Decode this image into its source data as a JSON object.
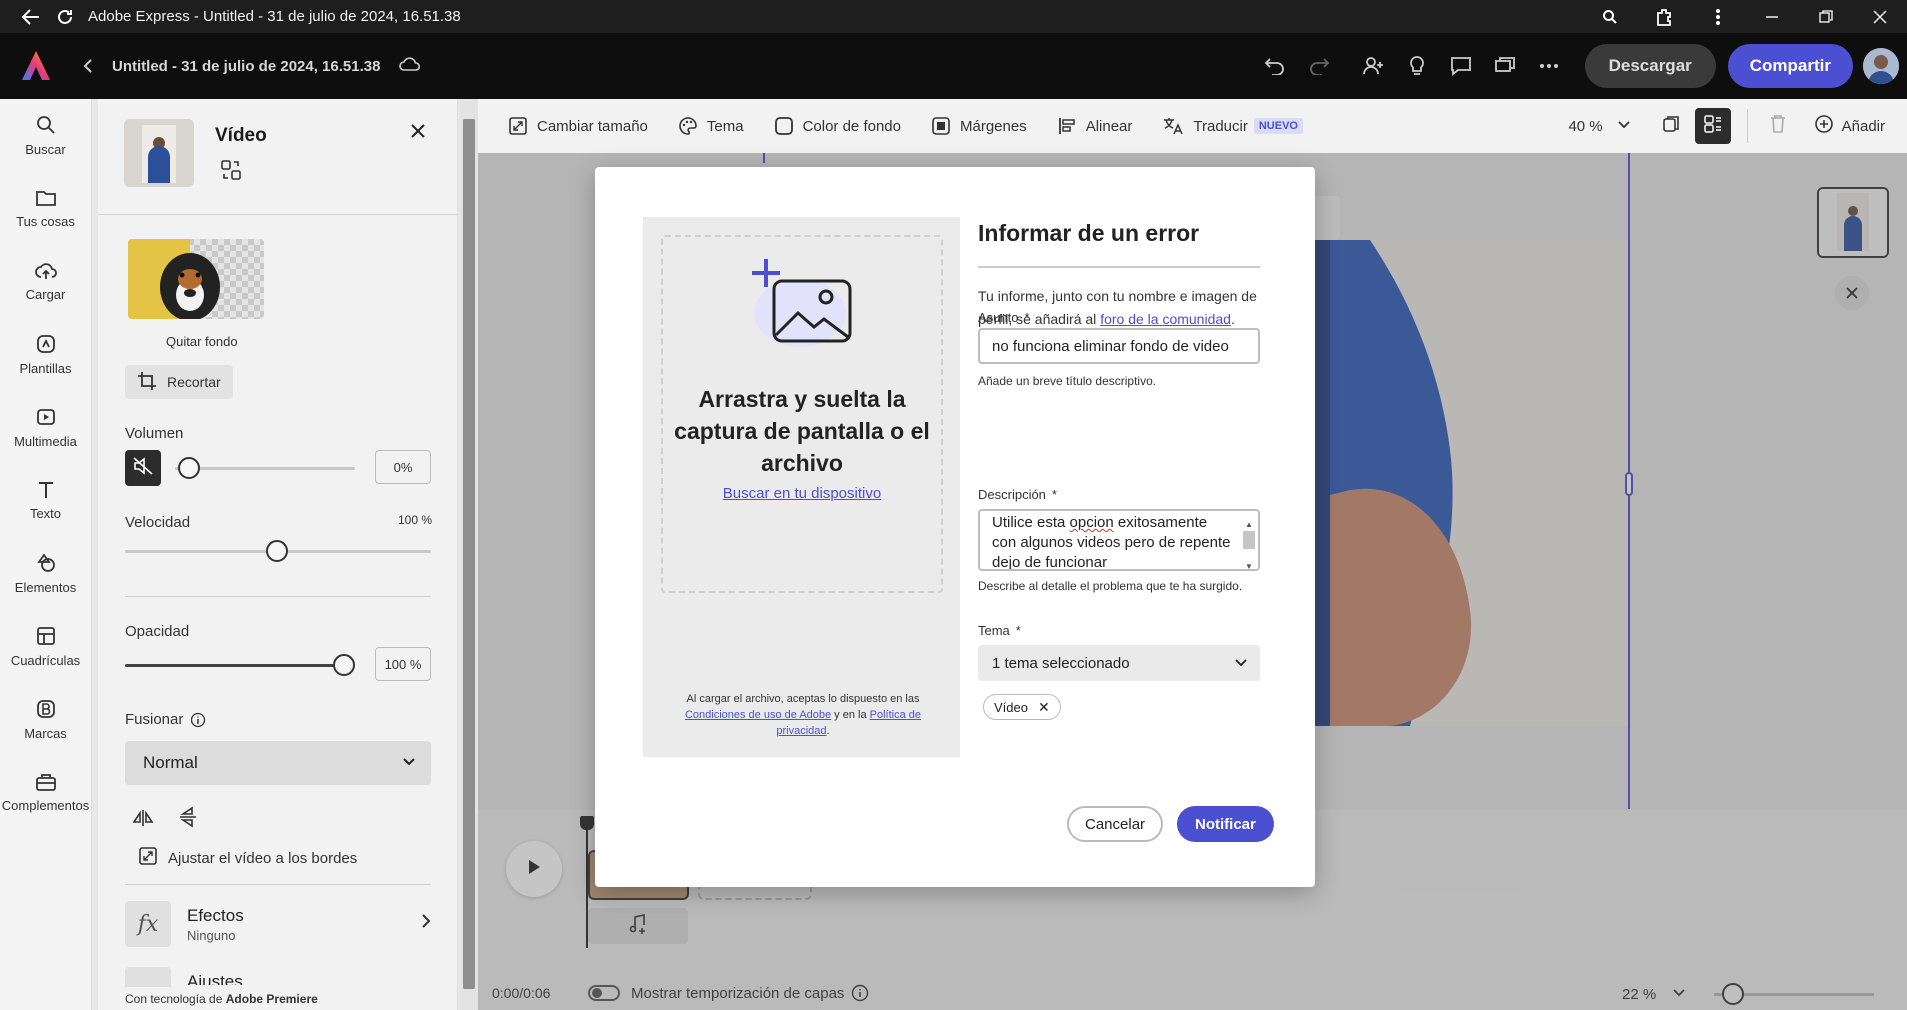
{
  "window": {
    "title": "Adobe Express - Untitled - 31 de julio de 2024, 16.51.38"
  },
  "app": {
    "doc_title": "Untitled - 31 de julio de 2024, 16.51.38",
    "download_label": "Descargar",
    "share_label": "Compartir",
    "brand_color": "#4b4fd1"
  },
  "rail": {
    "items": [
      {
        "label": "Buscar",
        "icon": "search-icon"
      },
      {
        "label": "Tus cosas",
        "icon": "folder-icon"
      },
      {
        "label": "Cargar",
        "icon": "upload-icon"
      },
      {
        "label": "Plantillas",
        "icon": "templates-icon"
      },
      {
        "label": "Multimedia",
        "icon": "media-icon"
      },
      {
        "label": "Texto",
        "icon": "text-icon"
      },
      {
        "label": "Elementos",
        "icon": "elements-icon"
      },
      {
        "label": "Cuadrículas",
        "icon": "grids-icon"
      },
      {
        "label": "Marcas",
        "icon": "brands-icon"
      },
      {
        "label": "Complementos",
        "icon": "addons-icon"
      }
    ]
  },
  "panel": {
    "title": "Vídeo",
    "remove_bg_label": "Quitar fondo",
    "crop_label": "Recortar",
    "volume_label": "Volumen",
    "volume_value": "0%",
    "volume_level": 0,
    "speed_label": "Velocidad",
    "speed_value": "100 %",
    "speed_level": 0.5,
    "opacity_label": "Opacidad",
    "opacity_value": "100 %",
    "opacity_level": 1.0,
    "blend_label": "Fusionar",
    "blend_value": "Normal",
    "fit_label": "Ajustar el vídeo a los bordes",
    "effects_title": "Efectos",
    "effects_value": "Ninguno",
    "adjust_partial": "Ajustes",
    "powered_prefix": "Con tecnología de ",
    "powered_brand": "Adobe Premiere"
  },
  "toolbar": {
    "resize": "Cambiar tamaño",
    "theme": "Tema",
    "bg_color": "Color de fondo",
    "margins": "Márgenes",
    "align": "Alinear",
    "translate": "Traducir",
    "new_badge": "NUEVO",
    "zoom": "40 %",
    "add": "Añadir"
  },
  "timeline": {
    "time": "0:00/0:06",
    "layer_timing_label": "Mostrar temporización de capas",
    "zoom": "22 %"
  },
  "modal": {
    "title": "Informar de un error",
    "desc_prefix": "Tu informe, junto con tu nombre e imagen de perfil, se añadirá al ",
    "desc_link": "foro de la comunidad",
    "desc_suffix": ".",
    "subject_label": "Asunto",
    "subject_value": "no funciona eliminar fondo de video",
    "subject_help": "Añade un breve título descriptivo.",
    "description_label": "Descripción",
    "description_line1_pre": "Utilice esta ",
    "description_line1_err": "opcion",
    "description_line1_post": " exitosamente",
    "description_line2": "con algunos videos pero de repente",
    "description_line3": "dejo de funcionar",
    "description_help": "Describe al detalle el problema que te ha surgido.",
    "topic_label": "Tema",
    "topic_value": "1 tema seleccionado",
    "topic_tag": "Vídeo",
    "required_mark": "*",
    "drop_title": "Arrastra y suelta la captura de pantalla o el archivo",
    "drop_link": "Buscar en tu dispositivo",
    "legal_pre": "Al cargar el archivo, aceptas lo dispuesto en las ",
    "legal_link1": "Condiciones de uso de Adobe",
    "legal_mid": " y en la ",
    "legal_link2": "Política de privacidad",
    "legal_end": ".",
    "cancel_label": "Cancelar",
    "notify_label": "Notificar"
  }
}
